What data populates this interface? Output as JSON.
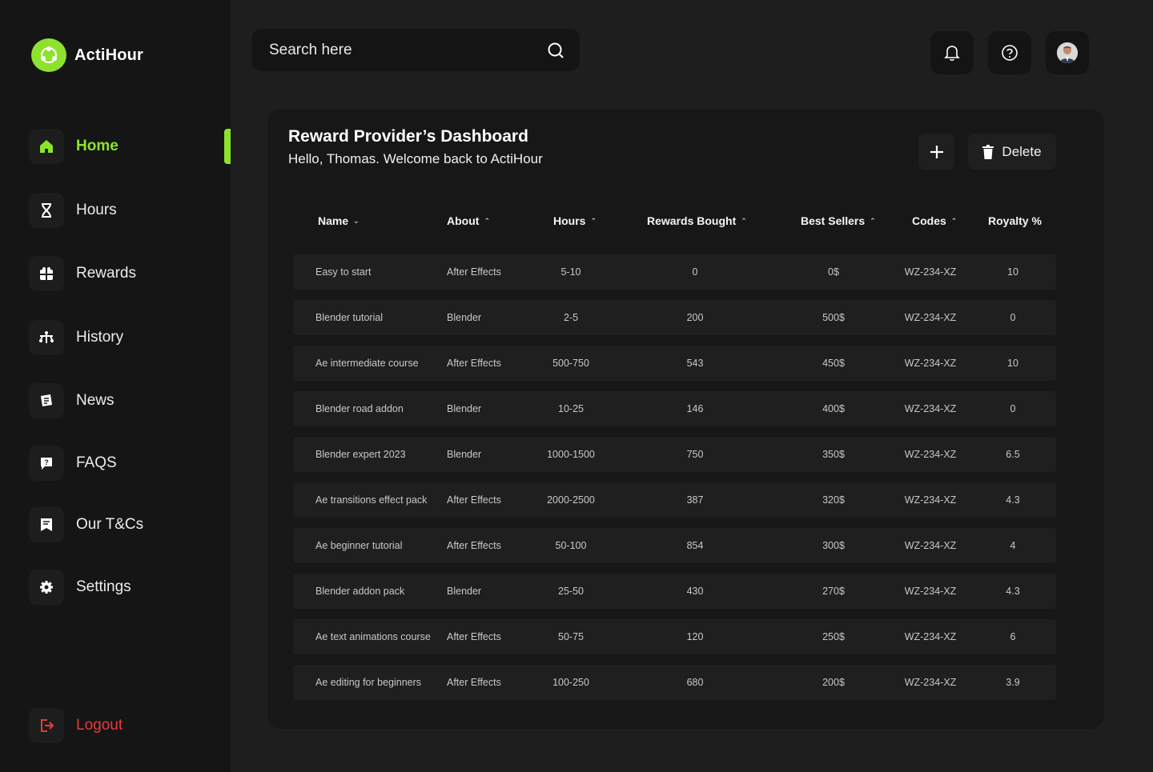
{
  "brand": {
    "name": "ActiHour",
    "accent": "#8de22e"
  },
  "sidebar": {
    "items": [
      {
        "label": "Home",
        "icon": "home-icon",
        "active": true
      },
      {
        "label": "Hours",
        "icon": "hourglass-icon",
        "active": false
      },
      {
        "label": "Rewards",
        "icon": "gift-icon",
        "active": false
      },
      {
        "label": "History",
        "icon": "history-icon",
        "active": false
      },
      {
        "label": "News",
        "icon": "news-icon",
        "active": false
      },
      {
        "label": "FAQS",
        "icon": "help-chat-icon",
        "active": false
      },
      {
        "label": "Our T&Cs",
        "icon": "document-icon",
        "active": false
      },
      {
        "label": "Settings",
        "icon": "gear-icon",
        "active": false
      }
    ],
    "logout": {
      "label": "Logout",
      "icon": "logout-icon",
      "color": "#e83a3a"
    }
  },
  "search": {
    "placeholder": "Search here"
  },
  "header": {
    "buttons": [
      "bell-icon",
      "help-icon",
      "avatar"
    ]
  },
  "dashboard": {
    "title": "Reward Provider’s Dashboard",
    "subtitle": "Hello, Thomas. Welcome back to ActiHour",
    "delete_label": "Delete"
  },
  "table": {
    "columns": [
      {
        "label": "Name",
        "sort": "down"
      },
      {
        "label": "About",
        "sort": "up"
      },
      {
        "label": "Hours",
        "sort": "up"
      },
      {
        "label": "Rewards Bought",
        "sort": "up"
      },
      {
        "label": "Best Sellers",
        "sort": "up"
      },
      {
        "label": "Codes",
        "sort": "up"
      },
      {
        "label": "Royalty %",
        "sort": ""
      }
    ],
    "rows": [
      [
        "Easy to start",
        "After Effects",
        "5-10",
        "0",
        "0$",
        "WZ-234-XZ",
        "10"
      ],
      [
        "Blender tutorial",
        "Blender",
        "2-5",
        "200",
        "500$",
        "WZ-234-XZ",
        "0"
      ],
      [
        "Ae intermediate course",
        "After Effects",
        "500-750",
        "543",
        "450$",
        "WZ-234-XZ",
        "10"
      ],
      [
        "Blender road addon",
        "Blender",
        "10-25",
        "146",
        "400$",
        "WZ-234-XZ",
        "0"
      ],
      [
        "Blender expert 2023",
        "Blender",
        "1000-1500",
        "750",
        "350$",
        "WZ-234-XZ",
        "6.5"
      ],
      [
        "Ae transitions effect pack",
        "After Effects",
        "2000-2500",
        "387",
        "320$",
        "WZ-234-XZ",
        "4.3"
      ],
      [
        "Ae beginner tutorial",
        "After Effects",
        "50-100",
        "854",
        "300$",
        "WZ-234-XZ",
        "4"
      ],
      [
        "Blender addon pack",
        "Blender",
        "25-50",
        "430",
        "270$",
        "WZ-234-XZ",
        "4.3"
      ],
      [
        "Ae text animations course",
        "After Effects",
        "50-75",
        "120",
        "250$",
        "WZ-234-XZ",
        "6"
      ],
      [
        "Ae editing for beginners",
        "After Effects",
        "100-250",
        "680",
        "200$",
        "WZ-234-XZ",
        "3.9"
      ]
    ]
  }
}
